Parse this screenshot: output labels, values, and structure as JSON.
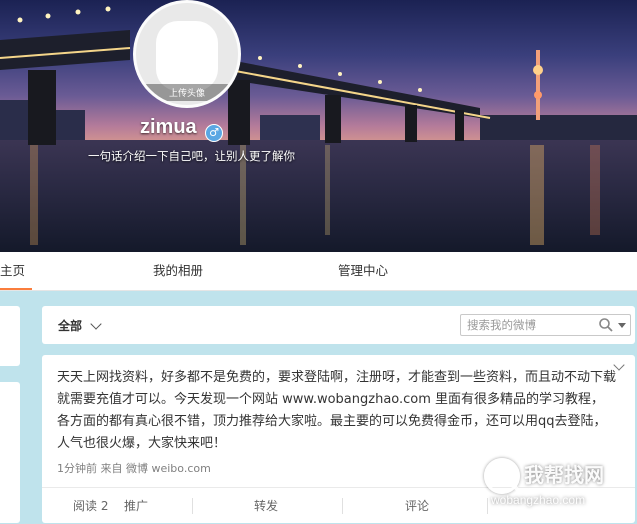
{
  "profile": {
    "avatar_upload_label": "上传头像",
    "username": "zimua",
    "gender_symbol": "♂",
    "bio": "一句话介绍一下自己吧，让别人更了解你"
  },
  "nav": {
    "home": "主页",
    "album": "我的相册",
    "admin": "管理中心"
  },
  "filter": {
    "all_label": "全部",
    "search_placeholder": "搜索我的微博"
  },
  "post": {
    "text": "天天上网找资料，好多都不是免费的，要求登陆啊，注册呀，才能查到一些资料，而且动不动下载就需要充值才可以。今天发现一个网站 www.wobangzhao.com 里面有很多精品的学习教程，各方面的都有真心很不错，顶力推荐给大家啦。最主要的可以免费得金币，还可以用qq去登陆，人气也很火爆，大家快来吧！",
    "meta": "1分钟前 来自 微博 weibo.com",
    "actions": {
      "read": "阅读 2",
      "promote": "推广",
      "repost": "转发",
      "comment": "评论"
    }
  },
  "watermark": {
    "cn": "我帮找网",
    "url": "wobangzhao.com"
  },
  "colors": {
    "accent": "#fa7d3c",
    "page_bg": "#bfe3ec",
    "badge": "#5aa7e3"
  }
}
